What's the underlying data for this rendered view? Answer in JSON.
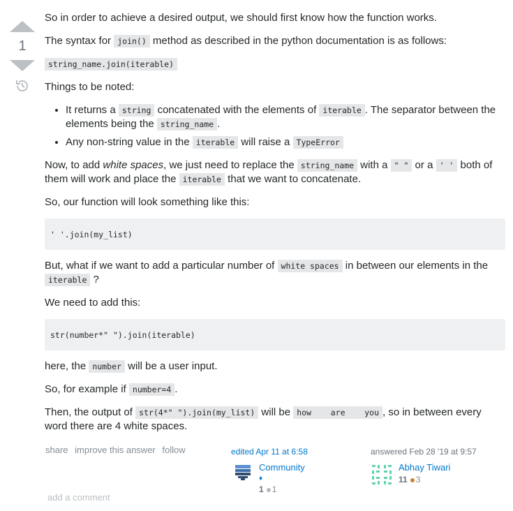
{
  "vote": {
    "count": "1"
  },
  "body": {
    "p1": "So in order to achieve a desired output, we should first know how the function works.",
    "p2_pre": "The syntax for ",
    "p2_code": "join()",
    "p2_post": " method as described in the python documentation is as follows:",
    "syntax_code": "string_name.join(iterable)",
    "p3": "Things to be noted:",
    "li1_a": "It returns a ",
    "li1_code1": "string",
    "li1_b": " concatenated with the elements of ",
    "li1_code2": "iterable",
    "li1_c": ". The separator between the elements being the ",
    "li1_code3": "string_name",
    "li1_d": ".",
    "li2_a": "Any non-string value in the ",
    "li2_code1": "iterable",
    "li2_b": " will raise a ",
    "li2_code2": "TypeError",
    "p4_a": "Now, to add ",
    "p4_em": "white spaces",
    "p4_b": ", we just need to replace the ",
    "p4_code1": "string_name",
    "p4_c": " with a ",
    "p4_code2": "\" \"",
    "p4_d": " or a ",
    "p4_code3": "' '",
    "p4_e": " both of them will work and place the ",
    "p4_code4": "iterable",
    "p4_f": " that we want to concatenate.",
    "p5": "So, our function will look something like this:",
    "code_block1": "' '.join(my_list)",
    "p6_a": "But, what if we want to add a particular number of ",
    "p6_code1": "white spaces",
    "p6_b": " in between our elements in the ",
    "p6_code2": "iterable",
    "p6_c": " ?",
    "p7": "We need to add this:",
    "code_block2": "str(number*\" \").join(iterable)",
    "p8_a": "here, the ",
    "p8_code": "number",
    "p8_b": " will be a user input.",
    "p9_a": "So, for example if ",
    "p9_code": "number=4",
    "p9_b": ".",
    "p10_a": "Then, the output of ",
    "p10_code1": "str(4*\" \").join(my_list)",
    "p10_b": " will be ",
    "p10_code2": "how    are    you",
    "p10_c": ", so in between every word there are 4 white spaces."
  },
  "menu": {
    "share": "share",
    "improve": "improve this answer",
    "follow": "follow"
  },
  "edited": {
    "action": "edited Apr 11 at 6:58",
    "name": "Community",
    "diamond": "♦",
    "rep": "1",
    "bronze": "1"
  },
  "answered": {
    "action": "answered Feb 28 '19 at 9:57",
    "name": "Abhay Tiwari",
    "rep": "11",
    "bronze": "3"
  },
  "comment": {
    "add": "add a comment"
  },
  "colors": {
    "link": "#0077cc",
    "bronze": "#cd7f32",
    "silver": "#b4b8bc",
    "code_bg": "#e4e6e8",
    "block_bg": "#eff0f1"
  }
}
